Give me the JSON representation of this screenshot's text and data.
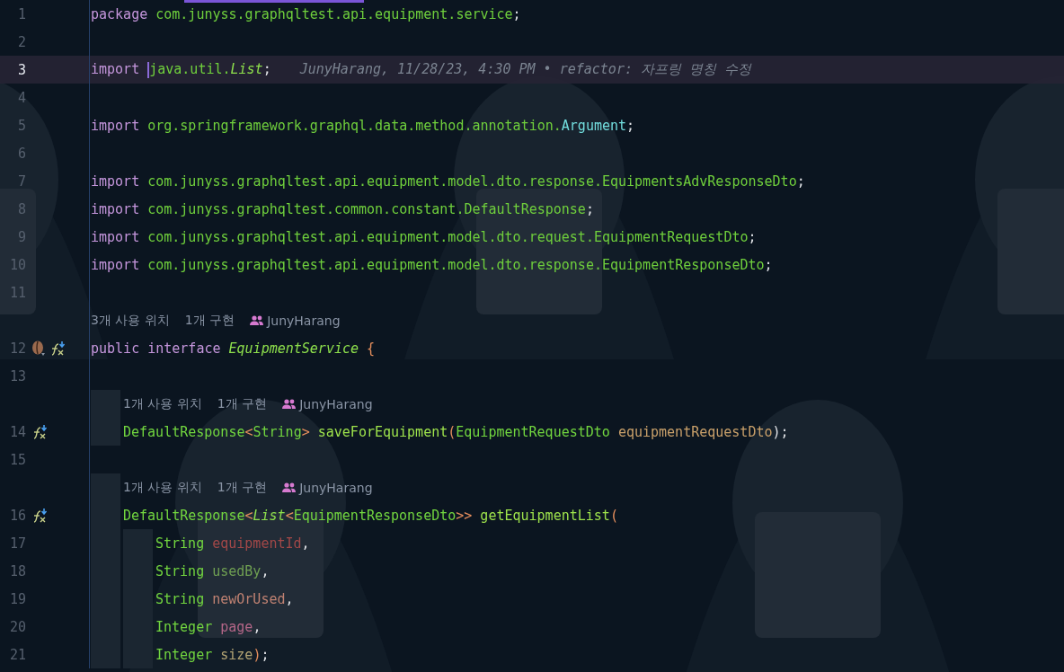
{
  "lines": [
    {
      "kind": "code",
      "number": "1",
      "current": false,
      "tokens": [
        {
          "text": "package",
          "kind": "keyword"
        },
        {
          "text": " com.junyss.graphqltest.api.equipment.service",
          "kind": "path"
        },
        {
          "text": ";",
          "kind": "plain"
        }
      ]
    },
    {
      "kind": "code",
      "number": "2",
      "current": false
    },
    {
      "kind": "code",
      "number": "3",
      "current": true,
      "tokens": [
        {
          "text": "import",
          "kind": "keyword"
        },
        {
          "text": " java.util.",
          "kind": "path",
          "caret_before": true
        },
        {
          "text": "List",
          "kind": "type"
        },
        {
          "text": ";",
          "kind": "plain"
        }
      ],
      "blame": "JunyHarang, 11/28/23, 4:30 PM • refactor: 자프링 명칭 수정"
    },
    {
      "kind": "code",
      "number": "4",
      "current": false
    },
    {
      "kind": "code",
      "number": "5",
      "current": false,
      "tokens": [
        {
          "text": "import",
          "kind": "keyword"
        },
        {
          "text": " org.springframework.graphql.data.method.annotation.",
          "kind": "path"
        },
        {
          "text": "Argument",
          "kind": "annotation"
        },
        {
          "text": ";",
          "kind": "plain"
        }
      ]
    },
    {
      "kind": "code",
      "number": "6",
      "current": false
    },
    {
      "kind": "code",
      "number": "7",
      "current": false,
      "tokens": [
        {
          "text": "import",
          "kind": "keyword"
        },
        {
          "text": " com.junyss.graphqltest.api.equipment.model.dto.response.EquipmentsAdvResponseDto",
          "kind": "path"
        },
        {
          "text": ";",
          "kind": "plain"
        }
      ]
    },
    {
      "kind": "code",
      "number": "8",
      "current": false,
      "tokens": [
        {
          "text": "import",
          "kind": "keyword"
        },
        {
          "text": " com.junyss.graphqltest.common.constant.DefaultResponse",
          "kind": "path"
        },
        {
          "text": ";",
          "kind": "plain"
        }
      ]
    },
    {
      "kind": "code",
      "number": "9",
      "current": false,
      "tokens": [
        {
          "text": "import",
          "kind": "keyword"
        },
        {
          "text": " com.junyss.graphqltest.api.equipment.model.dto.request.EquipmentRequestDto",
          "kind": "path"
        },
        {
          "text": ";",
          "kind": "plain"
        }
      ]
    },
    {
      "kind": "code",
      "number": "10",
      "current": false,
      "tokens": [
        {
          "text": "import",
          "kind": "keyword"
        },
        {
          "text": " com.junyss.graphqltest.api.equipment.model.dto.response.EquipmentResponseDto",
          "kind": "path"
        },
        {
          "text": ";",
          "kind": "plain"
        }
      ]
    },
    {
      "kind": "code",
      "number": "11",
      "current": false
    },
    {
      "kind": "hint",
      "items": [
        {
          "text": "3개 사용 위치",
          "kind": "usages"
        },
        {
          "text": "1개 구현",
          "kind": "implementations"
        },
        {
          "text": "JunyHarang",
          "kind": "author"
        }
      ]
    },
    {
      "kind": "code",
      "number": "12",
      "current": false,
      "gutter_icons": [
        {
          "kind": "bean"
        },
        {
          "kind": "implemented"
        }
      ],
      "tokens": [
        {
          "text": "public interface",
          "kind": "keyword"
        },
        {
          "text": " EquipmentService",
          "kind": "type"
        },
        {
          "text": " {",
          "kind": "bracket"
        }
      ],
      "children": [
        {
          "kind": "code",
          "number": "13",
          "current": false
        },
        {
          "kind": "hint",
          "items": [
            {
              "text": "1개 사용 위치",
              "kind": "usages"
            },
            {
              "text": "1개 구현",
              "kind": "implementations"
            },
            {
              "text": "JunyHarang",
              "kind": "author"
            }
          ]
        },
        {
          "kind": "code",
          "number": "14",
          "current": false,
          "gutter_icons": [
            {
              "kind": "implemented"
            }
          ],
          "tokens": [
            {
              "text": "DefaultResponse",
              "kind": "class"
            },
            {
              "text": "<",
              "kind": "bracket"
            },
            {
              "text": "String",
              "kind": "class"
            },
            {
              "text": ">",
              "kind": "bracket"
            },
            {
              "text": " saveForEquipment",
              "kind": "method"
            },
            {
              "text": "(",
              "kind": "bracket"
            },
            {
              "text": "EquipmentRequestDto",
              "kind": "class"
            },
            {
              "text": " equipmentRequestDto",
              "kind": "param",
              "color": "#c9a06a"
            },
            {
              "text": ");",
              "kind": "plain"
            }
          ]
        },
        {
          "kind": "code",
          "number": "15",
          "current": false
        },
        {
          "kind": "hint",
          "items": [
            {
              "text": "1개 사용 위치",
              "kind": "usages"
            },
            {
              "text": "1개 구현",
              "kind": "implementations"
            },
            {
              "text": "JunyHarang",
              "kind": "author"
            }
          ]
        },
        {
          "kind": "code",
          "number": "16",
          "current": false,
          "gutter_icons": [
            {
              "kind": "implemented"
            }
          ],
          "tokens": [
            {
              "text": "DefaultResponse",
              "kind": "class"
            },
            {
              "text": "<",
              "kind": "bracket"
            },
            {
              "text": "List",
              "kind": "type"
            },
            {
              "text": "<",
              "kind": "bracket"
            },
            {
              "text": "EquipmentResponseDto",
              "kind": "class"
            },
            {
              "text": ">>",
              "kind": "bracket"
            },
            {
              "text": " getEquipmentList",
              "kind": "method"
            },
            {
              "text": "(",
              "kind": "bracket"
            }
          ],
          "children": [
            {
              "kind": "code",
              "number": "17",
              "current": false,
              "tokens": [
                {
                  "text": "String",
                  "kind": "class"
                },
                {
                  "text": " equipmentId",
                  "kind": "param",
                  "color": "#a24848"
                },
                {
                  "text": ",",
                  "kind": "plain"
                }
              ]
            },
            {
              "kind": "code",
              "number": "18",
              "current": false,
              "tokens": [
                {
                  "text": "String",
                  "kind": "class"
                },
                {
                  "text": " usedBy",
                  "kind": "param",
                  "color": "#6f9f52"
                },
                {
                  "text": ",",
                  "kind": "plain"
                }
              ]
            },
            {
              "kind": "code",
              "number": "19",
              "current": false,
              "tokens": [
                {
                  "text": "String",
                  "kind": "class"
                },
                {
                  "text": " newOrUsed",
                  "kind": "param",
                  "color": "#c08272"
                },
                {
                  "text": ",",
                  "kind": "plain"
                }
              ]
            },
            {
              "kind": "code",
              "number": "20",
              "current": false,
              "tokens": [
                {
                  "text": "Integer",
                  "kind": "class"
                },
                {
                  "text": " page",
                  "kind": "param",
                  "color": "#b46688"
                },
                {
                  "text": ",",
                  "kind": "plain"
                }
              ]
            },
            {
              "kind": "code",
              "number": "21",
              "current": false,
              "tokens": [
                {
                  "text": "Integer",
                  "kind": "class"
                },
                {
                  "text": " size",
                  "kind": "param",
                  "color": "#b3a474"
                },
                {
                  "text": ")",
                  "kind": "bracket"
                },
                {
                  "text": ";",
                  "kind": "plain"
                }
              ]
            }
          ]
        }
      ]
    }
  ]
}
